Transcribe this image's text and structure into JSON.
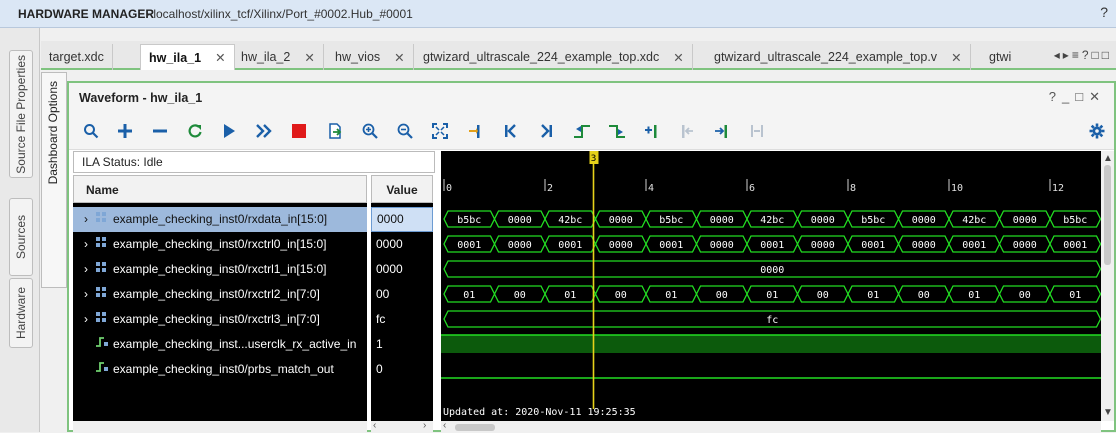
{
  "app": {
    "title": "HARDWARE MANAGER",
    "subtitle": "- localhost/xilinx_tcf/Xilinx/Port_#0002.Hub_#0001",
    "help": "?"
  },
  "left_tabs": [
    "Source File Properties",
    "Sources",
    "Hardware"
  ],
  "doc_tabs": [
    {
      "label": "target.xdc",
      "active": false,
      "closable": false
    },
    {
      "label": "hw_ila_1",
      "active": true,
      "closable": true
    },
    {
      "label": "hw_ila_2",
      "active": false,
      "closable": true
    },
    {
      "label": "hw_vios",
      "active": false,
      "closable": true
    },
    {
      "label": "gtwizard_ultrascale_224_example_top.xdc",
      "active": false,
      "closable": true
    },
    {
      "label": "gtwizard_ultrascale_224_example_top.v",
      "active": false,
      "closable": true
    },
    {
      "label": "gtwi",
      "active": false,
      "closable": false
    }
  ],
  "dashboard_label": "Dashboard Options",
  "panel": {
    "title": "Waveform - hw_ila_1"
  },
  "toolbar_icons": [
    "search-icon",
    "plus-icon",
    "minus-icon",
    "refresh-icon",
    "run-trigger-icon",
    "run-immediate-icon",
    "stop-icon",
    "export-icon",
    "zoom-in-icon",
    "zoom-out-icon",
    "zoom-fit-icon",
    "cursor-icon",
    "go-start-icon",
    "go-end-icon",
    "prev-transition-icon",
    "next-transition-icon",
    "add-marker-icon",
    "prev-marker-icon",
    "next-marker-icon",
    "swap-cursors-icon",
    "gear-icon"
  ],
  "ila_status": "ILA Status:  Idle",
  "columns": {
    "name": "Name",
    "value": "Value"
  },
  "signals": [
    {
      "name": "example_checking_inst0/rxdata_in[15:0]",
      "value": "0000",
      "expandable": true,
      "selected": true,
      "type": "bus"
    },
    {
      "name": "example_checking_inst0/rxctrl0_in[15:0]",
      "value": "0000",
      "expandable": true,
      "selected": false,
      "type": "bus"
    },
    {
      "name": "example_checking_inst0/rxctrl1_in[15:0]",
      "value": "0000",
      "expandable": true,
      "selected": false,
      "type": "bus"
    },
    {
      "name": "example_checking_inst0/rxctrl2_in[7:0]",
      "value": "00",
      "expandable": true,
      "selected": false,
      "type": "bus"
    },
    {
      "name": "example_checking_inst0/rxctrl3_in[7:0]",
      "value": "fc",
      "expandable": true,
      "selected": false,
      "type": "bus"
    },
    {
      "name": "example_checking_inst...userclk_rx_active_in",
      "value": "1",
      "expandable": false,
      "selected": false,
      "type": "bit"
    },
    {
      "name": "example_checking_inst0/prbs_match_out",
      "value": "0",
      "expandable": false,
      "selected": false,
      "type": "bit"
    }
  ],
  "waveform": {
    "time_range": [
      0,
      13
    ],
    "ticks": [
      0,
      2,
      4,
      6,
      8,
      10,
      12
    ],
    "cursor": {
      "time": 3,
      "label": "3"
    },
    "rows": [
      {
        "segments": [
          [
            "b5bc",
            0,
            1
          ],
          [
            "0000",
            1,
            2
          ],
          [
            "42bc",
            2,
            3
          ],
          [
            "0000",
            3,
            4
          ],
          [
            "b5bc",
            4,
            5
          ],
          [
            "0000",
            5,
            6
          ],
          [
            "42bc",
            6,
            7
          ],
          [
            "0000",
            7,
            8
          ],
          [
            "b5bc",
            8,
            9
          ],
          [
            "0000",
            9,
            10
          ],
          [
            "42bc",
            10,
            11
          ],
          [
            "0000",
            11,
            12
          ],
          [
            "b5bc",
            12,
            13
          ]
        ]
      },
      {
        "segments": [
          [
            "0001",
            0,
            1
          ],
          [
            "0000",
            1,
            2
          ],
          [
            "0001",
            2,
            3
          ],
          [
            "0000",
            3,
            4
          ],
          [
            "0001",
            4,
            5
          ],
          [
            "0000",
            5,
            6
          ],
          [
            "0001",
            6,
            7
          ],
          [
            "0000",
            7,
            8
          ],
          [
            "0001",
            8,
            9
          ],
          [
            "0000",
            9,
            10
          ],
          [
            "0001",
            10,
            11
          ],
          [
            "0000",
            11,
            12
          ],
          [
            "0001",
            12,
            13
          ]
        ]
      },
      {
        "segments": [
          [
            "0000",
            0,
            13
          ]
        ]
      },
      {
        "segments": [
          [
            "01",
            0,
            1
          ],
          [
            "00",
            1,
            2
          ],
          [
            "01",
            2,
            3
          ],
          [
            "00",
            3,
            4
          ],
          [
            "01",
            4,
            5
          ],
          [
            "00",
            5,
            6
          ],
          [
            "01",
            6,
            7
          ],
          [
            "00",
            7,
            8
          ],
          [
            "01",
            8,
            9
          ],
          [
            "00",
            9,
            10
          ],
          [
            "01",
            10,
            11
          ],
          [
            "00",
            11,
            12
          ],
          [
            "01",
            12,
            13
          ]
        ]
      },
      {
        "segments": [
          [
            "fc",
            0,
            13
          ]
        ]
      },
      {
        "bit": 1
      },
      {
        "bit": 0
      }
    ],
    "updated": "Updated at: 2020-Nov-11 19:25:35"
  },
  "colors": {
    "wave": "#22dd22",
    "cursor": "#e6d21a",
    "high_fill": "#0c5a0c",
    "panel_border": "#7fc37f"
  }
}
